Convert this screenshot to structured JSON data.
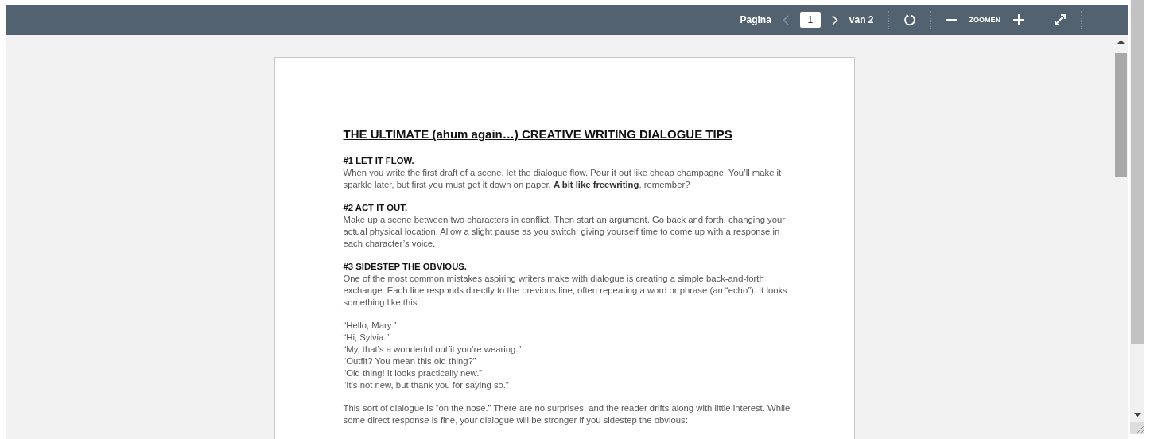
{
  "toolbar": {
    "page_label": "Pagina",
    "prev_page": {
      "disabled": true
    },
    "page_input": {
      "value": "1"
    },
    "next_page": {
      "disabled": false
    },
    "page_total": "van 2",
    "zoom_label": "ZOOMEN"
  },
  "document": {
    "title": "THE ULTIMATE (ahum again…) CREATIVE WRITING DIALOGUE TIPS",
    "blocks": [
      {
        "kind": "heading",
        "text": "#1 LET IT FLOW."
      },
      {
        "kind": "paragraph",
        "text": "When you write the first draft of a scene, let the dialogue flow. Pour it out like cheap champagne. You’ll make it sparkle later, but first you must get it down on paper. **A bit like freewriting**, remember?"
      },
      {
        "kind": "heading",
        "text": "#2 ACT IT OUT."
      },
      {
        "kind": "paragraph",
        "text": "Make up a scene between two characters in conflict. Then start an argument. Go back and forth, changing your actual physical location. Allow a slight pause as you switch, giving yourself time to come up with a response in each character’s voice."
      },
      {
        "kind": "heading",
        "text": "#3 SIDESTEP THE OBVIOUS."
      },
      {
        "kind": "paragraph",
        "text": "One of the most common mistakes aspiring writers make with dialogue is creating a simple back-and-forth exchange. Each line responds directly to the previous line, often repeating a word or phrase (an “echo”). It looks something like this:"
      },
      {
        "kind": "gap"
      },
      {
        "kind": "line",
        "text": "“Hello, Mary.”"
      },
      {
        "kind": "line",
        "text": "“Hi, Sylvia.”"
      },
      {
        "kind": "line",
        "text": "“My, that’s a wonderful outfit you’re wearing.”"
      },
      {
        "kind": "line",
        "text": "“Outfit? You mean this old thing?”"
      },
      {
        "kind": "line",
        "text": "“Old thing! It looks practically new.”"
      },
      {
        "kind": "line",
        "text": "“It’s not new, but thank you for saying so.”"
      },
      {
        "kind": "gap"
      },
      {
        "kind": "paragraph",
        "text": "This sort of dialogue is “on the nose.” There are no surprises, and the reader drifts along with little interest. While some direct response is fine, your dialogue will be stronger if you sidestep the obvious:"
      }
    ]
  }
}
